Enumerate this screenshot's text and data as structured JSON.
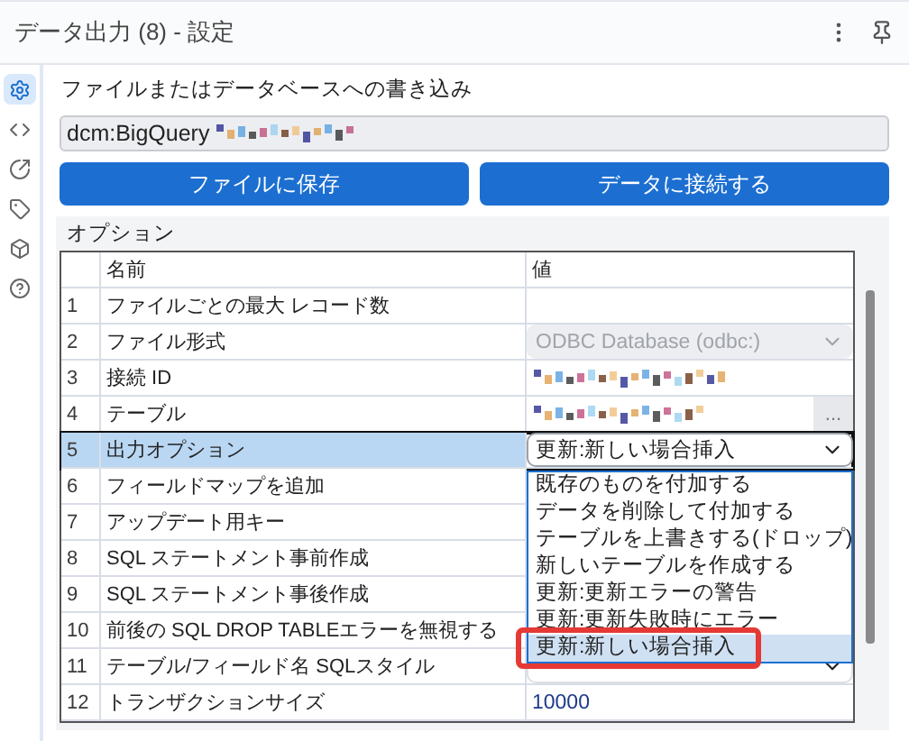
{
  "window": {
    "title": "データ出力 (8) - 設定"
  },
  "sidebar": {
    "items": [
      {
        "kind": "settings",
        "selected": true
      },
      {
        "kind": "code",
        "selected": false
      },
      {
        "kind": "export",
        "selected": false
      },
      {
        "kind": "tag",
        "selected": false
      },
      {
        "kind": "cube",
        "selected": false
      },
      {
        "kind": "help",
        "selected": false
      }
    ]
  },
  "section_title": "ファイルまたはデータベースへの書き込み",
  "connection_field": {
    "value": "dcm:BigQuery"
  },
  "buttons": [
    "ファイルに保存",
    "データに接続する"
  ],
  "options": {
    "label": "オプション",
    "columns": [
      "名前",
      "値"
    ],
    "rows": [
      {
        "number": "1",
        "name": "ファイルごとの最大 レコード数",
        "selected": false,
        "value": {
          "kind": "empty"
        }
      },
      {
        "number": "2",
        "name": "ファイル形式",
        "selected": false,
        "value": {
          "kind": "select",
          "text": "ODBC Database (odbc:)",
          "disabled": true
        }
      },
      {
        "number": "3",
        "name": "接続 ID",
        "selected": false,
        "value": {
          "kind": "redacted"
        }
      },
      {
        "number": "4",
        "name": "テーブル",
        "selected": false,
        "value": {
          "kind": "redacted_browse",
          "button": "..."
        }
      },
      {
        "number": "5",
        "name": "出力オプション",
        "selected": true,
        "value": {
          "kind": "select",
          "text": "更新:新しい場合挿入",
          "disabled": false,
          "expanded": true
        }
      },
      {
        "number": "6",
        "name": "フィールドマップを追加",
        "selected": false,
        "value": {
          "kind": "empty"
        }
      },
      {
        "number": "7",
        "name": "アップデート用キー",
        "selected": false,
        "value": {
          "kind": "empty"
        }
      },
      {
        "number": "8",
        "name": "SQL ステートメント事前作成",
        "selected": false,
        "value": {
          "kind": "empty"
        }
      },
      {
        "number": "9",
        "name": "SQL ステートメント事後作成",
        "selected": false,
        "value": {
          "kind": "empty"
        }
      },
      {
        "number": "10",
        "name": "前後の SQL DROP TABLEエラーを無視する",
        "selected": false,
        "value": {
          "kind": "empty"
        }
      },
      {
        "number": "11",
        "name": "テーブル/フィールド名 SQLスタイル",
        "selected": false,
        "value": {
          "kind": "select",
          "disabled": false
        }
      },
      {
        "number": "12",
        "name": "トランザクションサイズ",
        "selected": false,
        "value": {
          "kind": "text",
          "text": "10000"
        }
      }
    ]
  },
  "dropdown": {
    "items": [
      {
        "label": "既存のものを付加する",
        "selected": false,
        "circled": false
      },
      {
        "label": "データを削除して付加する",
        "selected": false,
        "circled": false
      },
      {
        "label": "テーブルを上書きする(ドロップ)",
        "selected": false,
        "circled": false
      },
      {
        "label": "新しいテーブルを作成する",
        "selected": false,
        "circled": false
      },
      {
        "label": "更新:更新エラーの警告",
        "selected": false,
        "circled": false
      },
      {
        "label": "更新:更新失敗時にエラー",
        "selected": false,
        "circled": false
      },
      {
        "label": "更新:新しい場合挿入",
        "selected": true,
        "circled": true
      }
    ]
  }
}
